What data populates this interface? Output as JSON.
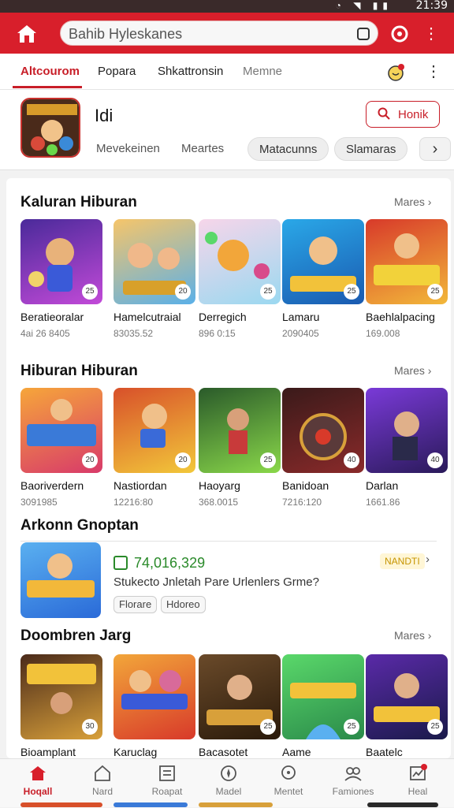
{
  "status": {
    "time": "21:39",
    "icons": "◔ ◥ ▮▮"
  },
  "search": {
    "placeholder": "Bahib Hyleskanes",
    "value": "Bahib Hyleskanes"
  },
  "tabs": [
    {
      "label": "Altcourom",
      "active": true
    },
    {
      "label": "Popara"
    },
    {
      "label": "Shkattronsin"
    },
    {
      "label": "Memne"
    }
  ],
  "app": {
    "title": "Idi",
    "button_label": "Honik",
    "chips": [
      "Mevekeinen",
      "Meartes",
      "Matacunns",
      "Slamaras"
    ]
  },
  "sections": [
    {
      "title": "Kaluran Hiburan",
      "more": "Mares",
      "items": [
        {
          "name": "Beratieoralar",
          "size": "4ai 26 8405",
          "badge": "25"
        },
        {
          "name": "Hamelcutraial",
          "size": "83035.52",
          "badge": "20"
        },
        {
          "name": "Derregich",
          "size": "896 0:15",
          "badge": "25"
        },
        {
          "name": "Lamaru",
          "size": "2090405",
          "badge": "25"
        },
        {
          "name": "Baehlalpacing",
          "size": "169.008",
          "badge": "25"
        }
      ]
    },
    {
      "title": "Hiburan Hiburan",
      "more": "Mares",
      "items": [
        {
          "name": "Baoriverdern",
          "size": "3091985",
          "badge": "20"
        },
        {
          "name": "Nastiordan",
          "size": "12216:80",
          "badge": "20"
        },
        {
          "name": "Haoyarg",
          "size": "368.0015",
          "badge": "25"
        },
        {
          "name": "Banidoan",
          "size": "7216:120",
          "badge": "40"
        },
        {
          "name": "Darlan",
          "size": "1661.86",
          "badge": "40"
        }
      ]
    },
    {
      "title": "Doombren Jarg",
      "more": "Mares",
      "items": [
        {
          "name": "Bioamplant",
          "size": "",
          "badge": "30"
        },
        {
          "name": "Karuclag",
          "size": "",
          "badge": ""
        },
        {
          "name": "Bacasotet",
          "size": "",
          "badge": "25"
        },
        {
          "name": "Aame",
          "size": "",
          "badge": "25"
        },
        {
          "name": "Baatelc",
          "size": "",
          "badge": "25"
        }
      ]
    }
  ],
  "featured": {
    "title": "Arkonn Gnoptan",
    "count": "74,016,329",
    "desc": "Stukecto Jnletah Pare Urlenlers Grme?",
    "tags": [
      "Florare",
      "Hdoreo"
    ],
    "new_label": "NANDTI"
  },
  "nav": [
    {
      "label": "Hoqall",
      "icon": "home-icon",
      "active": true
    },
    {
      "label": "Nard",
      "icon": "house-outline-icon"
    },
    {
      "label": "Roapat",
      "icon": "document-icon"
    },
    {
      "label": "Madel",
      "icon": "compass-icon"
    },
    {
      "label": "Mentet",
      "icon": "search-icon"
    },
    {
      "label": "Famiones",
      "icon": "people-icon"
    },
    {
      "label": "Heal",
      "icon": "chart-icon"
    }
  ],
  "colors": {
    "brand": "#d81f2b",
    "accent_green": "#2a8a2a"
  }
}
